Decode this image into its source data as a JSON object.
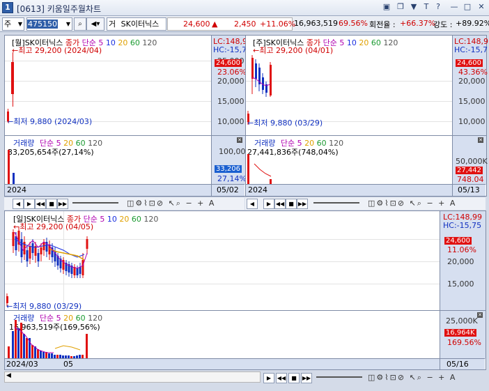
{
  "window": {
    "number": "1",
    "title": "[0613] 키움일주월차트",
    "buttons": [
      "▣",
      "❐",
      "▼",
      "T",
      "?",
      "—",
      "□",
      "✕"
    ]
  },
  "toolbar": {
    "market": "주",
    "code": "475150",
    "search_icon": "search-icon",
    "sound_icon": "speaker-icon",
    "prefix": "거",
    "stock_name": "SK이터닉스",
    "price": "24,600",
    "change_arrow": "▲",
    "change": "2,450",
    "change_pct": "+11.06%",
    "volume": "16,963,519",
    "volume_pct": "69.56%",
    "turnover_label": "회전율 :",
    "turnover": "+66.37%",
    "strength_label": "강도 :",
    "strength": "+89.92%"
  },
  "colors": {
    "up": "#e01010",
    "down": "#1030c0",
    "ma5": "#b000b0",
    "ma10": "#1a2fe0",
    "ma20": "#e0a000",
    "ma60": "#1a9a30",
    "ma120": "#555555"
  },
  "monthly": {
    "title": "[월]SK이터닉스",
    "legend": {
      "kind": "종가",
      "type": "단순",
      "ma": [
        "5",
        "10",
        "20",
        "60",
        "120"
      ]
    },
    "lc": "LC:148,9",
    "hc": "HC:-15,7",
    "high_label": "최고 29,200 (2024/04)",
    "low_label": "최저 9,880 (2024/03)",
    "price_tag": "24,600",
    "pct_tag": "23.06%",
    "ticks": [
      "25,000",
      "20,000",
      "15,000",
      "10,000"
    ],
    "vol_title": "거래량",
    "vol_legend": {
      "type": "단순",
      "ma": [
        "5",
        "20",
        "60",
        "120"
      ]
    },
    "vol_value": "33,205,654주(27,14%)",
    "vol_tick": "100,000",
    "vol_tag": "33,206",
    "vol_pct_tag": "27,14%",
    "x_start": "2024",
    "x_end": "05/02"
  },
  "weekly": {
    "title": "[주]SK이터닉스",
    "legend": {
      "kind": "종가",
      "type": "단순",
      "ma": [
        "5",
        "10",
        "20",
        "60",
        "120"
      ]
    },
    "lc": "LC:148,9",
    "hc": "HC:-15,7",
    "high_label": "최고 29,200 (04/01)",
    "low_label": "최저 9,880 (03/29)",
    "price_tag": "24,600",
    "pct_tag": "43.36%",
    "ticks": [
      "20,000",
      "15,000",
      "10,000"
    ],
    "vol_title": "거래량",
    "vol_legend": {
      "type": "단순",
      "ma": [
        "5",
        "20",
        "60",
        "120"
      ]
    },
    "vol_value": "27,441,836주(748,04%)",
    "vol_tick": "50,000K",
    "vol_tag": "27,442",
    "vol_pct_tag": "748.04",
    "x_start": "2024",
    "x_end": "05/13"
  },
  "daily": {
    "title": "[일]SK이터닉스",
    "legend": {
      "kind": "종가",
      "type": "단순",
      "ma": [
        "5",
        "10",
        "20",
        "60",
        "120"
      ]
    },
    "lc": "LC:148,99",
    "hc": "HC:-15,75",
    "high_label": "최고 29,200 (04/05)",
    "low_label": "최저 9,880 (03/29)",
    "price_tag": "24,600",
    "pct_tag": "11.06%",
    "ticks": [
      "20,000",
      "15,000"
    ],
    "vol_title": "거래량",
    "vol_legend": {
      "type": "단순",
      "ma": [
        "5",
        "20",
        "60",
        "120"
      ]
    },
    "vol_value": "16,963,519주(169,56%)",
    "vol_tick": "25,000K",
    "vol_tag": "16,964K",
    "vol_pct_tag": "169.56%",
    "x_start": "2024/03",
    "x_mid": "05",
    "x_end": "05/16"
  }
}
